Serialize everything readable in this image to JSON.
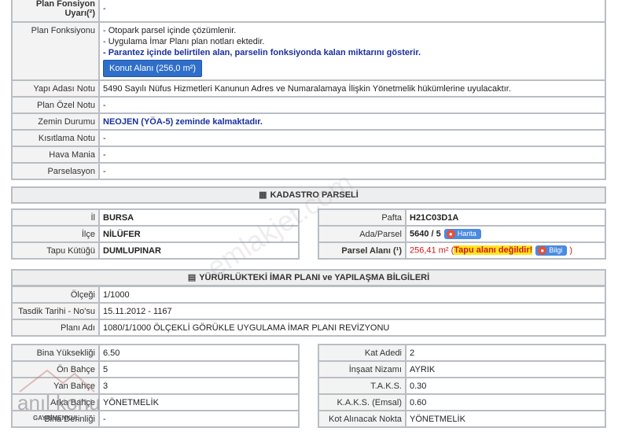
{
  "top": {
    "uyari_label": "Plan Fonsiyon Uyarı(²)",
    "uyari_value": "-",
    "fonksiyon_label": "Plan Fonksiyonu",
    "fonksiyon_lines": [
      "- Otopark parsel içinde çözümlenir.",
      "- Uygulama İmar Planı plan notları ektedir."
    ],
    "fonksiyon_note": "- Parantez içinde belirtilen alan, parselin fonksiyonda kalan miktarını gösterir.",
    "konut_button": "Konut Alanı (256,0 m²)",
    "yapi_adasi_label": "Yapı Adası Notu",
    "yapi_adasi_value": "5490 Sayılı Nüfus Hizmetleri Kanunun Adres ve Numaralamaya İlişkin Yönetmelik hükümlerine uyulacaktır.",
    "plan_ozel_label": "Plan Özel Notu",
    "plan_ozel_value": "-",
    "zemin_label": "Zemin Durumu",
    "zemin_value": "NEOJEN (YÖA-5) zeminde kalmaktadır.",
    "kisitlama_label": "Kısıtlama Notu",
    "kisitlama_value": "-",
    "hava_label": "Hava Mania",
    "hava_value": "-",
    "parselasyon_label": "Parselasyon",
    "parselasyon_value": "-"
  },
  "kadastro": {
    "title": "KADASTRO PARSELİ",
    "il_label": "İl",
    "il_value": "BURSA",
    "ilce_label": "İlçe",
    "ilce_value": "NİLÜFER",
    "tapu_label": "Tapu Kütüğü",
    "tapu_value": "DUMLUPINAR",
    "pafta_label": "Pafta",
    "pafta_value": "H21C03D1A",
    "ada_label": "Ada/Parsel",
    "ada_value": "5640 / 5",
    "harita_button": "Harita",
    "alan_label": "Parsel Alanı (¹)",
    "alan_value": "256,41 m²",
    "alan_note": "Tapu alanı değildir!",
    "bilgi_button": "Bilgi",
    "paren_open": "(",
    "paren_close": ")"
  },
  "imar": {
    "title": "YÜRÜRLÜKTEKİ İMAR PLANI ve YAPILAŞMA BİLGİLERİ",
    "olcek_label": "Ölçeği",
    "olcek_value": "1/1000",
    "tasdik_label": "Tasdik Tarihi - No'su",
    "tasdik_value": "15.11.2012 - 1167",
    "plan_adi_label": "Planı Adı",
    "plan_adi_value": "1080/1/1000 ÖLÇEKLİ GÖRÜKLE UYGULAMA İMAR PLANI REVİZYONU"
  },
  "yapilasma_left": [
    {
      "label": "Bina Yüksekliği",
      "value": "6.50"
    },
    {
      "label": "Ön Bahçe",
      "value": "5"
    },
    {
      "label": "Yan Bahçe",
      "value": "3"
    },
    {
      "label": "Arka Bahçe",
      "value": "YÖNETMELİK"
    },
    {
      "label": "Bina Derinliği",
      "value": "-"
    }
  ],
  "yapilasma_right": [
    {
      "label": "Kat Adedi",
      "value": "2"
    },
    {
      "label": "İnşaat Nizamı",
      "value": "AYRIK"
    },
    {
      "label": "T.A.K.S.",
      "value": "0.30"
    },
    {
      "label": "K.A.K.S. (Emsal)",
      "value": "0.60"
    },
    {
      "label": "Kot Alınacak Nokta",
      "value": "YÖNETMELİK"
    }
  ],
  "watermark": "emlakjet.com",
  "logo": {
    "name": "anıl konu",
    "sub": "GAYRİMENKUL"
  }
}
